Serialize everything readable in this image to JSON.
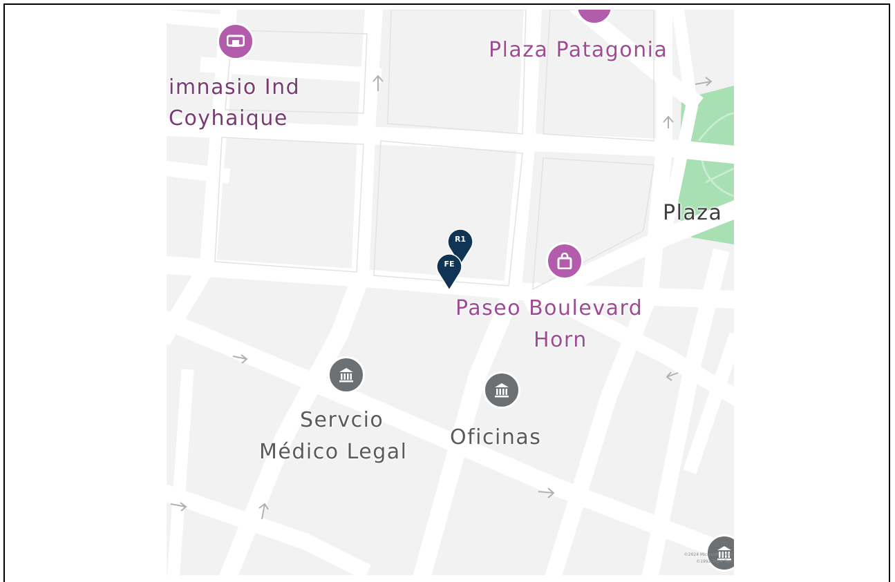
{
  "map": {
    "labels": {
      "gimnasio_line1": "imnasio Ind",
      "gimnasio_line2": "Coyhaique",
      "plaza_patagonia": "Plaza Patagonia",
      "plaza": "Plaza",
      "paseo_line1": "Paseo Boulevard",
      "paseo_line2": "Horn",
      "servicio_line1": "Servcio",
      "servicio_line2": "Médico Legal",
      "oficinas": "Oficinas"
    },
    "pins": [
      {
        "id": "R1",
        "label": "R1",
        "color": "#0f3454"
      },
      {
        "id": "FE",
        "label": "FE",
        "color": "#0f3454"
      }
    ],
    "icons": {
      "gym": "gym-icon",
      "shopping": "shopping-bag-icon",
      "government": "government-building-icon"
    },
    "colors": {
      "background": "#f2f2f3",
      "road": "#ffffff",
      "park": "#a8dfb3",
      "shop_label": "#9c4b94",
      "shop_icon": "#b35cab",
      "gov_icon": "#6d7073",
      "pin": "#0f3454"
    },
    "copyright_line1": "©2024 Microsoft Corpo",
    "copyright_line2": "©1992-2024 Tom"
  }
}
